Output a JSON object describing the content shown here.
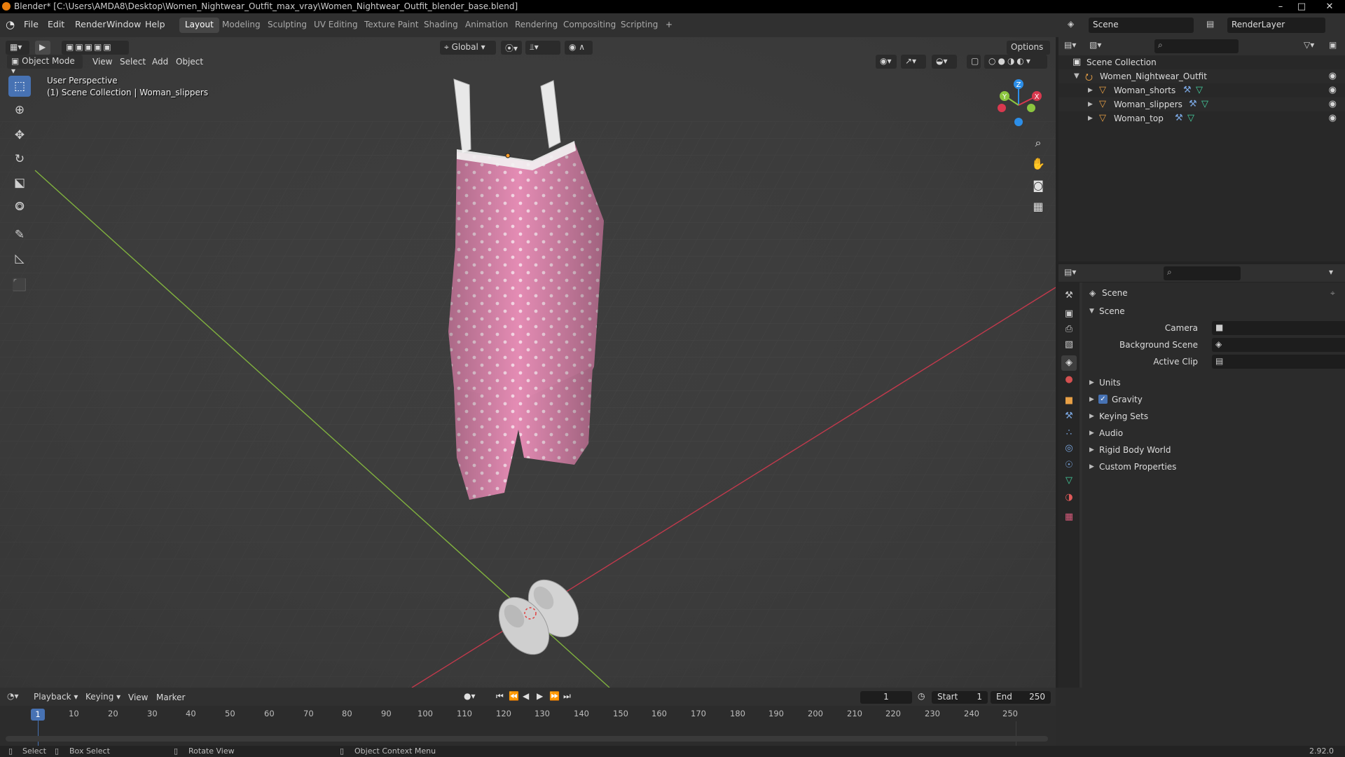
{
  "window": {
    "title": "Blender* [C:\\Users\\AMDA8\\Desktop\\Women_Nightwear_Outfit_max_vray\\Women_Nightwear_Outfit_blender_base.blend]",
    "minimize": "–",
    "maximize": "□",
    "close": "✕"
  },
  "menu": [
    "File",
    "Edit",
    "Render",
    "Window",
    "Help"
  ],
  "workspaces": [
    "Layout",
    "Modeling",
    "Sculpting",
    "UV Editing",
    "Texture Paint",
    "Shading",
    "Animation",
    "Rendering",
    "Compositing",
    "Scripting"
  ],
  "workspace_add": "+",
  "scene_field": "Scene",
  "render_layer_field": "RenderLayer",
  "viewport": {
    "transform_orientation": "Global",
    "options_label": "Options",
    "mode": "Object Mode",
    "header_menus": [
      "View",
      "Select",
      "Add",
      "Object"
    ],
    "overlay_line1": "User Perspective",
    "overlay_line2": "(1) Scene Collection | Woman_slippers",
    "gizmo_labels": {
      "x": "X",
      "y": "Y",
      "z": "Z"
    }
  },
  "outliner": {
    "root": "Scene Collection",
    "collection": "Women_Nightwear_Outfit",
    "objects": [
      "Woman_shorts",
      "Woman_slippers",
      "Woman_top"
    ]
  },
  "properties": {
    "context_title": "Scene",
    "panel_title": "Scene",
    "fields": [
      {
        "label": "Camera",
        "value": ""
      },
      {
        "label": "Background Scene",
        "value": ""
      },
      {
        "label": "Active Clip",
        "value": ""
      }
    ],
    "sections": [
      "Units",
      "Gravity",
      "Keying Sets",
      "Audio",
      "Rigid Body World",
      "Custom Properties"
    ],
    "gravity_checked": true
  },
  "timeline": {
    "menus": [
      "Playback",
      "Keying",
      "View",
      "Marker"
    ],
    "current_frame": "1",
    "start_label": "Start",
    "start_value": "1",
    "end_label": "End",
    "end_value": "250",
    "ruler_current": "1",
    "ticks": [
      "10",
      "20",
      "30",
      "40",
      "50",
      "60",
      "70",
      "80",
      "90",
      "100",
      "110",
      "120",
      "130",
      "140",
      "150",
      "160",
      "170",
      "180",
      "190",
      "200",
      "210",
      "220",
      "230",
      "240",
      "250"
    ]
  },
  "status": {
    "select": "Select",
    "box_select": "Box Select",
    "rotate_view": "Rotate View",
    "context_menu": "Object Context Menu",
    "version": "2.92.0"
  },
  "colors": {
    "accent": "#4772b3",
    "x_axis": "#d9394f",
    "y_axis": "#8cc63f",
    "z_axis": "#2c8ee8",
    "garment": "#e48cb4"
  }
}
